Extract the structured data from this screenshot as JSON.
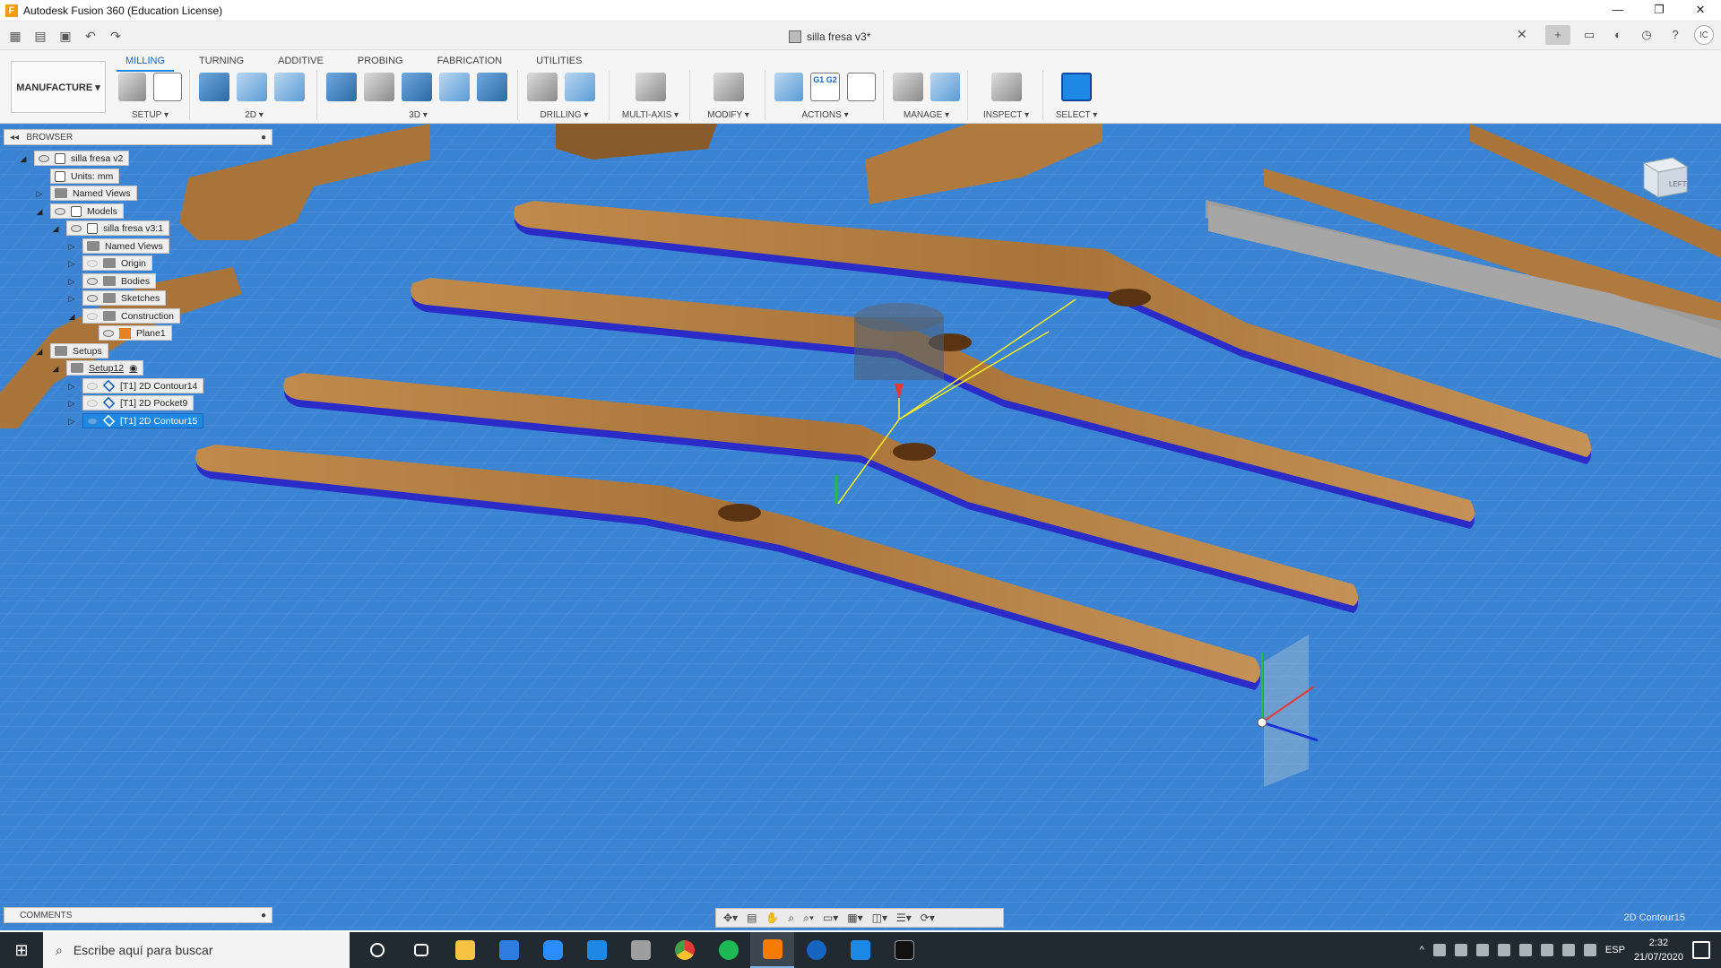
{
  "window": {
    "title": "Autodesk Fusion 360 (Education License)",
    "controls": [
      "—",
      "❐",
      "✕"
    ]
  },
  "document": {
    "tab_title": "silla fresa v3*",
    "close_glyph": "✕"
  },
  "ribbon": {
    "workspace": "MANUFACTURE ▾",
    "tabs": [
      "MILLING",
      "TURNING",
      "ADDITIVE",
      "PROBING",
      "FABRICATION",
      "UTILITIES"
    ],
    "active_tab": "MILLING",
    "groups": [
      {
        "label": "SETUP ▾"
      },
      {
        "label": "2D ▾"
      },
      {
        "label": "3D ▾"
      },
      {
        "label": "DRILLING ▾"
      },
      {
        "label": "MULTI-AXIS ▾"
      },
      {
        "label": "MODIFY ▾"
      },
      {
        "label": "ACTIONS ▾"
      },
      {
        "label": "MANAGE ▾"
      },
      {
        "label": "INSPECT ▾"
      },
      {
        "label": "SELECT ▾"
      }
    ],
    "actions_g_label": "G1 G2"
  },
  "browser": {
    "title": "BROWSER",
    "nodes": [
      {
        "label": "silla fresa v2"
      },
      {
        "label": "Units: mm"
      },
      {
        "label": "Named Views"
      },
      {
        "label": "Models"
      },
      {
        "label": "silla fresa v3:1"
      },
      {
        "label": "Named Views"
      },
      {
        "label": "Origin"
      },
      {
        "label": "Bodies"
      },
      {
        "label": "Sketches"
      },
      {
        "label": "Construction"
      },
      {
        "label": "Plane1"
      },
      {
        "label": "Setups"
      },
      {
        "label": "Setup12"
      },
      {
        "label": "[T1] 2D Contour14"
      },
      {
        "label": "[T1] 2D Pocket9"
      },
      {
        "label": "[T1] 2D Contour15"
      }
    ]
  },
  "comments": {
    "title": "COMMENTS"
  },
  "viewcube": {
    "face": "LEFT"
  },
  "status": {
    "operation": "2D Contour15"
  },
  "taskbar": {
    "search_placeholder": "Escribe aquí para buscar",
    "language": "ESP",
    "time": "2:32",
    "date": "21/07/2020"
  },
  "user": {
    "initials": "IC"
  },
  "colors": {
    "viewport_bg": "#3b84d4",
    "accent": "#1e88e5",
    "wood": "#b07a3f",
    "toolpath": "#1a2fd6"
  }
}
